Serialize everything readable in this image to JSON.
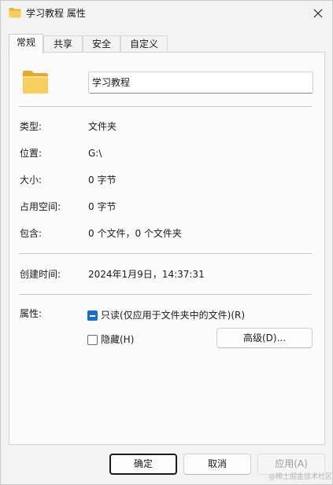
{
  "window": {
    "title": "学习教程 属性",
    "title_icon": "folder-icon",
    "close_icon": "close-icon"
  },
  "tabs": [
    {
      "label": "常规",
      "active": true
    },
    {
      "label": "共享",
      "active": false
    },
    {
      "label": "安全",
      "active": false
    },
    {
      "label": "自定义",
      "active": false
    }
  ],
  "general": {
    "folder_icon": "folder-icon",
    "name_value": "学习教程",
    "type": {
      "label": "类型:",
      "value": "文件夹"
    },
    "location": {
      "label": "位置:",
      "value": "G:\\"
    },
    "size": {
      "label": "大小:",
      "value": "0 字节"
    },
    "size_on_disk": {
      "label": "占用空间:",
      "value": "0 字节"
    },
    "contains": {
      "label": "包含:",
      "value": "0 个文件，0 个文件夹"
    },
    "created": {
      "label": "创建时间:",
      "value": "2024年1月9日，14:37:31"
    },
    "attributes": {
      "label": "属性:",
      "readonly": {
        "label": "只读(仅应用于文件夹中的文件)(R)",
        "state": "indeterminate"
      },
      "hidden": {
        "label": "隐藏(H)",
        "state": "unchecked"
      },
      "advanced_button": "高级(D)..."
    }
  },
  "footer": {
    "ok": "确定",
    "cancel": "取消",
    "apply": "应用(A)"
  },
  "watermark": "@稀土掘金技术社区",
  "colors": {
    "accent": "#1a6fc4",
    "window_bg": "#f3f3f3",
    "panel_bg": "#fbfbfb"
  }
}
